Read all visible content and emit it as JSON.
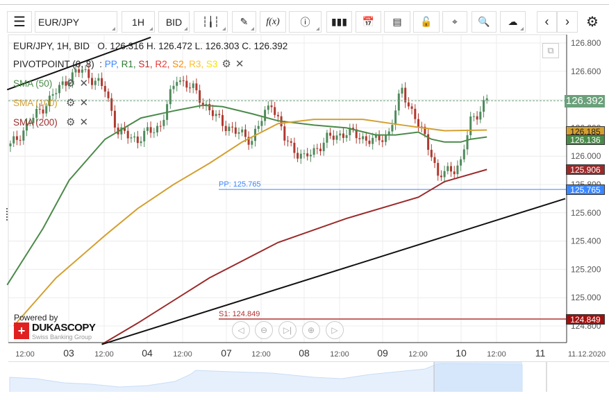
{
  "toolbar": {
    "symbol": "EUR/JPY",
    "timeframe": "1H",
    "side": "BID",
    "fx_label": "f(x)"
  },
  "legend": {
    "title": "EUR/JPY, 1H, BID",
    "ohlc": "O. 126.316 H. 126.472 L. 126.303 C. 126.392",
    "pivot_name": "PIVOTPOINT (0, 8)",
    "pivot_items": [
      {
        "t": "PP",
        "c": "#3a86ff"
      },
      {
        "t": "R1",
        "c": "#2e7d32"
      },
      {
        "t": "S1",
        "c": "#c62828"
      },
      {
        "t": "R2",
        "c": "#e53935"
      },
      {
        "t": "S2",
        "c": "#fb8c00"
      },
      {
        "t": "R3",
        "c": "#fbc02d"
      },
      {
        "t": "S3",
        "c": "#f5e400"
      }
    ],
    "sma": [
      {
        "label": "SMA (50)",
        "color": "#4a8a4a"
      },
      {
        "label": "SMA (100)",
        "color": "#d4a030"
      },
      {
        "label": "SMA (200)",
        "color": "#9b2a2a"
      }
    ]
  },
  "chart_data": {
    "type": "candlestick",
    "ylim": [
      124.7,
      126.9
    ],
    "y_ticks": [
      "126.800",
      "126.600",
      "126.400",
      "126.200",
      "126.000",
      "125.800",
      "125.600",
      "125.400",
      "125.200",
      "125.000",
      "124.800"
    ],
    "x_ticks": [
      "12:00",
      "03",
      "12:00",
      "04",
      "12:00",
      "07",
      "12:00",
      "08",
      "12:00",
      "09",
      "12:00",
      "10",
      "12:00",
      "11",
      "11.12.2020"
    ],
    "close_waypoints": [
      [
        0,
        126.07
      ],
      [
        7,
        126.27
      ],
      [
        18,
        126.56
      ],
      [
        22,
        126.61
      ],
      [
        29,
        126.47
      ],
      [
        33,
        126.17
      ],
      [
        39,
        126.12
      ],
      [
        46,
        126.22
      ],
      [
        51,
        126.56
      ],
      [
        56,
        126.47
      ],
      [
        63,
        126.27
      ],
      [
        69,
        126.17
      ],
      [
        74,
        126.12
      ],
      [
        80,
        126.39
      ],
      [
        84,
        126.12
      ],
      [
        90,
        125.98
      ],
      [
        97,
        126.12
      ],
      [
        103,
        126.17
      ],
      [
        112,
        126.1
      ],
      [
        116,
        126.17
      ],
      [
        120,
        126.47
      ],
      [
        125,
        126.22
      ],
      [
        129,
        126.03
      ],
      [
        131,
        125.85
      ],
      [
        138,
        125.95
      ],
      [
        141,
        126.25
      ],
      [
        146,
        126.392
      ]
    ],
    "sma50": [
      [
        -1,
        125.09
      ],
      [
        10,
        125.49
      ],
      [
        18,
        125.83
      ],
      [
        29,
        126.12
      ],
      [
        40,
        126.27
      ],
      [
        50,
        126.32
      ],
      [
        59,
        126.36
      ],
      [
        65,
        126.35
      ],
      [
        74,
        126.3
      ],
      [
        82,
        126.25
      ],
      [
        93,
        126.22
      ],
      [
        103,
        126.2
      ],
      [
        112,
        126.15
      ],
      [
        118,
        126.15
      ],
      [
        125,
        126.17
      ],
      [
        129,
        126.12
      ],
      [
        133,
        126.1
      ],
      [
        138,
        126.1
      ],
      [
        141,
        126.12
      ],
      [
        146,
        126.136
      ]
    ],
    "sma100": [
      [
        1,
        124.8
      ],
      [
        14,
        125.14
      ],
      [
        29,
        125.44
      ],
      [
        39,
        125.63
      ],
      [
        50,
        125.8
      ],
      [
        61,
        125.95
      ],
      [
        71,
        126.1
      ],
      [
        82,
        126.23
      ],
      [
        93,
        126.26
      ],
      [
        108,
        126.26
      ],
      [
        120,
        126.22
      ],
      [
        133,
        126.18
      ],
      [
        146,
        126.185
      ]
    ],
    "sma200": [
      [
        28,
        124.67
      ],
      [
        39,
        124.82
      ],
      [
        61,
        125.14
      ],
      [
        82,
        125.39
      ],
      [
        103,
        125.56
      ],
      [
        125,
        125.71
      ],
      [
        133,
        125.82
      ],
      [
        146,
        125.906
      ]
    ],
    "trendlines": [
      [
        [
          28,
          124.67
        ],
        [
          170,
          125.7
        ]
      ],
      [
        [
          -1,
          126.47
        ],
        [
          43,
          126.84
        ]
      ]
    ],
    "last_price": "126.392",
    "price_labels": [
      {
        "v": "126.185",
        "c": "#d4a030",
        "fg": "#222"
      },
      {
        "v": "126.136",
        "c": "#4a8a4a",
        "fg": "#fff"
      },
      {
        "v": "125.906",
        "c": "#9b2a2a",
        "fg": "#fff"
      },
      {
        "v": "125.765",
        "c": "#3a86ff",
        "fg": "#fff"
      },
      {
        "v": "124.849",
        "c": "#a01010",
        "fg": "#fff"
      }
    ],
    "pp": {
      "label": "PP: 125.765",
      "value": 125.765
    },
    "s1": {
      "label": "S1: 124.849",
      "value": 124.849
    }
  },
  "branding": {
    "powered": "Powered by",
    "name": "DUKASCOPY",
    "sub": "Swiss Banking Group"
  }
}
